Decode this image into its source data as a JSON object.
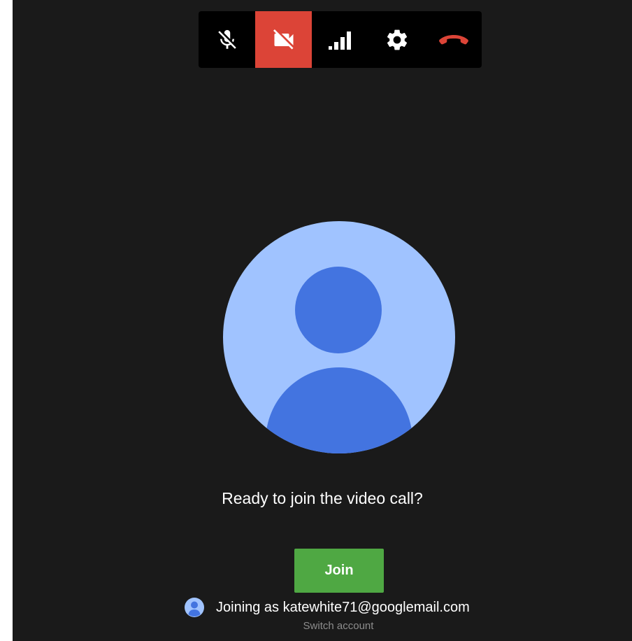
{
  "toolbar": {
    "buttons": [
      {
        "icon": "mic-off-icon",
        "state": "muted"
      },
      {
        "icon": "video-off-icon",
        "state": "off"
      },
      {
        "icon": "signal-strength-icon",
        "state": "normal"
      },
      {
        "icon": "gear-icon",
        "state": "normal"
      },
      {
        "icon": "hang-up-icon",
        "state": "normal"
      }
    ],
    "colors": {
      "active_button_bg": "#dc4437",
      "hangup_icon": "#dc4437",
      "icon": "#ffffff"
    }
  },
  "avatar": {
    "circle_color": "#a0c3ff",
    "figure_color": "#4374e0"
  },
  "prompt": {
    "text": "Ready to join the video call?"
  },
  "join": {
    "label": "Join",
    "color": "#4fa843"
  },
  "account": {
    "joining_text": "Joining as katewhite71@googlemail.com",
    "switch_label": "Switch account"
  }
}
